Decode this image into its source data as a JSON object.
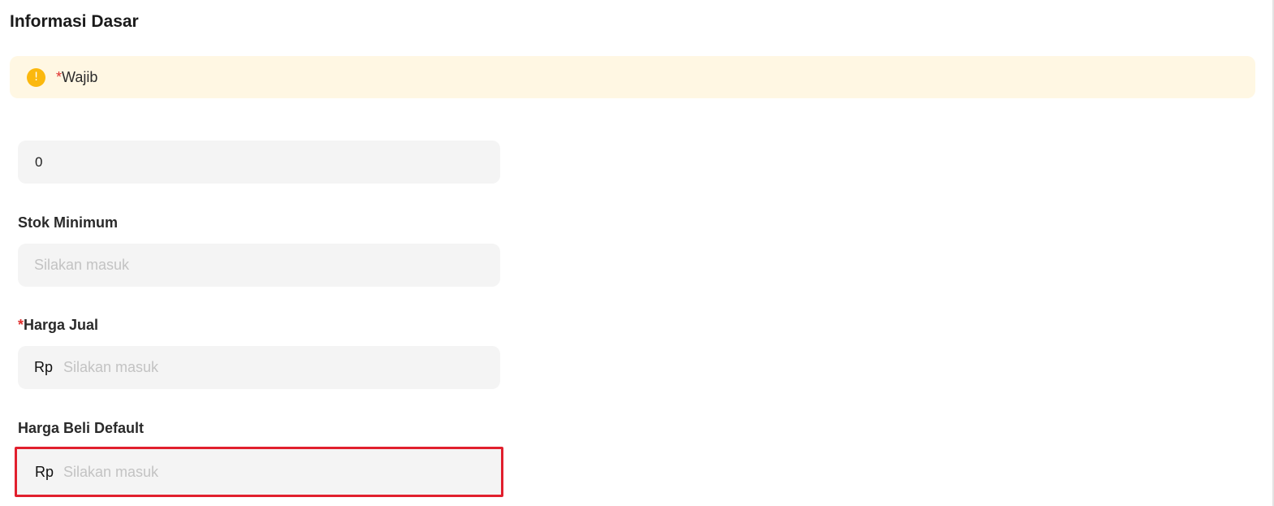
{
  "section": {
    "title": "Informasi Dasar"
  },
  "notice": {
    "icon": "info-icon",
    "icon_glyph": "!",
    "required_mark": "*",
    "text": "Wajib",
    "accent_color": "#fbb80e",
    "background_color": "#fff7e3"
  },
  "fields": {
    "stock": {
      "value": "0"
    },
    "min_stock": {
      "label": "Stok Minimum",
      "placeholder": "Silakan masuk"
    },
    "sell_price": {
      "required_mark": "*",
      "label": "Harga Jual",
      "prefix": "Rp",
      "placeholder": "Silakan masuk"
    },
    "default_buy_price": {
      "label": "Harga Beli Default",
      "prefix": "Rp",
      "placeholder": "Silakan masuk",
      "highlight_color": "#e11f2d"
    }
  }
}
